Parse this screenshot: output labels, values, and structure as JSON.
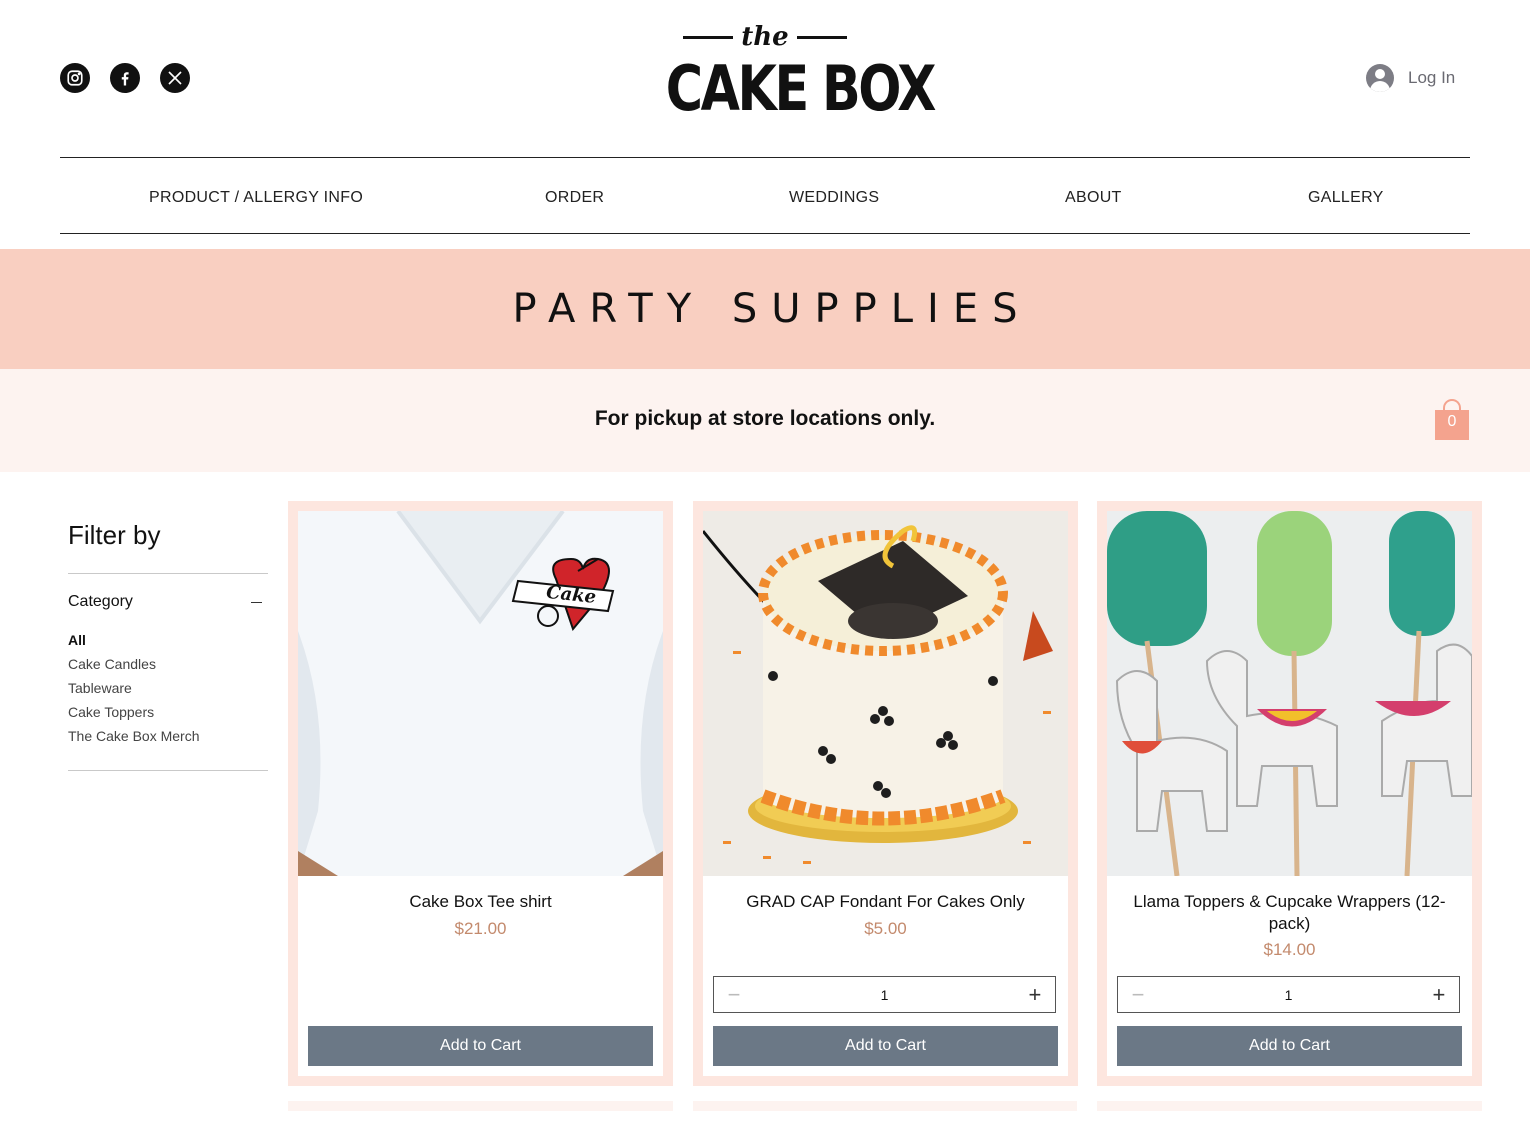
{
  "header": {
    "social": [
      {
        "icon": "instagram-icon"
      },
      {
        "icon": "facebook-icon"
      },
      {
        "icon": "x-twitter-icon"
      }
    ],
    "logo": {
      "the": "the",
      "name": "CAKE BOX"
    },
    "login_label": "Log In"
  },
  "nav": {
    "items": [
      {
        "label": "PRODUCT / ALLERGY INFO"
      },
      {
        "label": "ORDER"
      },
      {
        "label": "WEDDINGS"
      },
      {
        "label": "ABOUT"
      },
      {
        "label": "GALLERY"
      }
    ]
  },
  "banner": {
    "title": "PARTY SUPPLIES"
  },
  "notice": {
    "text": "For pickup at store locations only."
  },
  "cart": {
    "count": "0",
    "color": "#f4a38e"
  },
  "filter": {
    "title": "Filter by",
    "category_label": "Category",
    "options": [
      {
        "label": "All",
        "selected": true
      },
      {
        "label": "Cake Candles",
        "selected": false
      },
      {
        "label": "Tableware",
        "selected": false
      },
      {
        "label": "Cake Toppers",
        "selected": false
      },
      {
        "label": "The Cake Box Merch",
        "selected": false
      }
    ]
  },
  "products": [
    {
      "name": "Cake Box Tee shirt",
      "price": "$21.00",
      "button": "Add to Cart",
      "image": "white t-shirt with heart cake logo"
    },
    {
      "name": "GRAD CAP Fondant For Cakes Only",
      "price": "$5.00",
      "quantity": "1",
      "button": "Add to Cart",
      "image": "cake with graduation cap topper"
    },
    {
      "name": "Llama Toppers & Cupcake Wrappers (12-pack)",
      "price": "$14.00",
      "quantity": "1",
      "button": "Add to Cart",
      "image": "llama and cactus cake toppers"
    }
  ],
  "colors": {
    "banner": "#f9cfc1",
    "notice_bg": "#fdf3f0",
    "card_border": "#fde6df",
    "button": "#6b7886",
    "price": "#c38a6d"
  }
}
